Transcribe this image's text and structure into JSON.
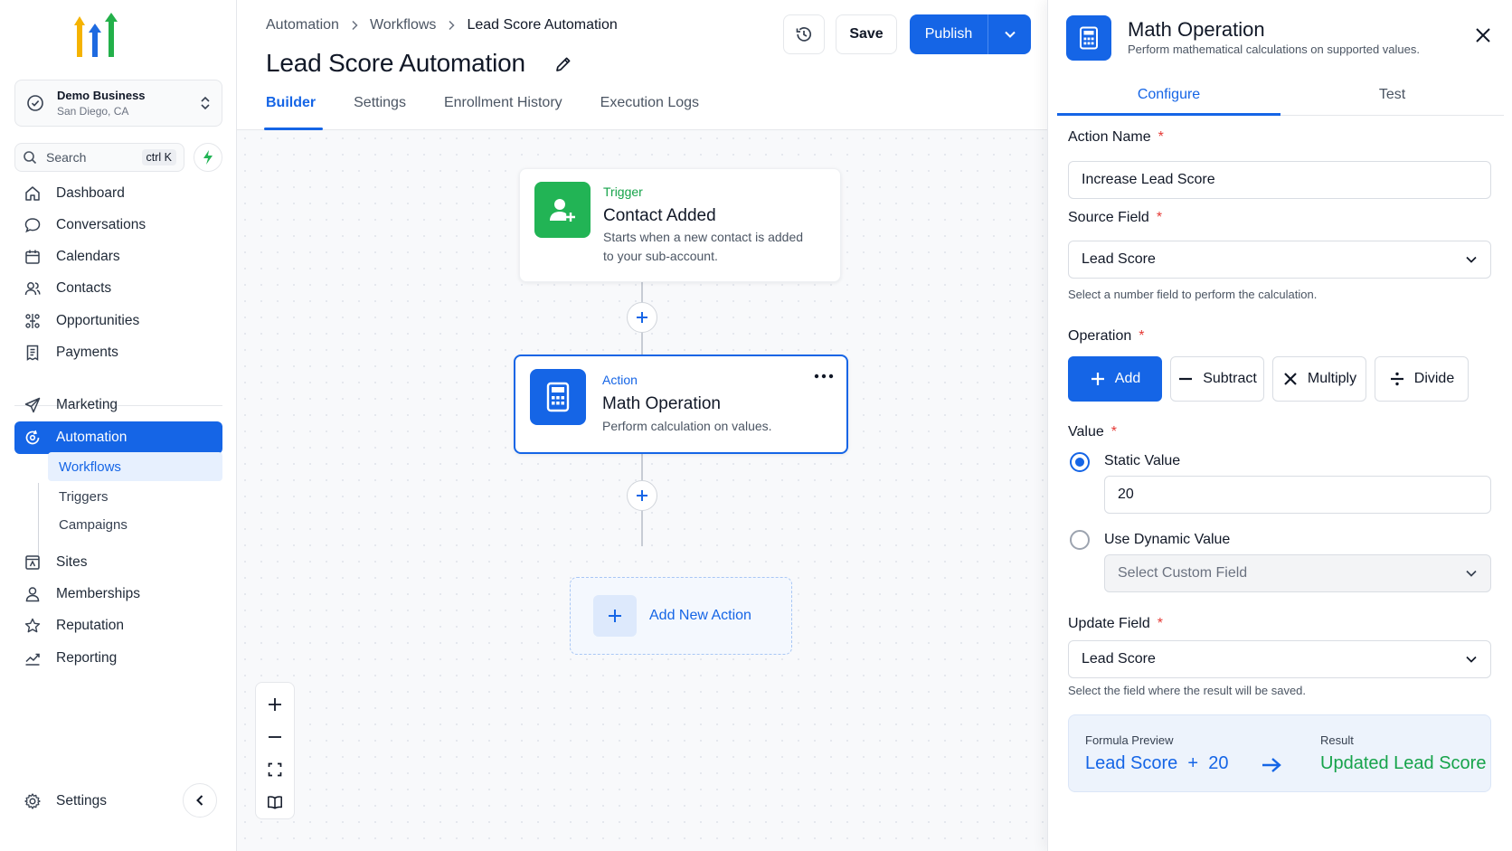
{
  "sidebar": {
    "business": {
      "name": "Demo Business",
      "location": "San Diego, CA"
    },
    "search": {
      "placeholder": "Search",
      "shortcut": "ctrl K"
    },
    "nav": [
      {
        "label": "Dashboard",
        "icon": "home-icon"
      },
      {
        "label": "Conversations",
        "icon": "chat-bubble-icon"
      },
      {
        "label": "Calendars",
        "icon": "calendar-icon"
      },
      {
        "label": "Contacts",
        "icon": "users-icon"
      },
      {
        "label": "Opportunities",
        "icon": "funnel-icon"
      },
      {
        "label": "Payments",
        "icon": "receipt-icon"
      },
      {
        "label": "Marketing",
        "icon": "send-icon"
      },
      {
        "label": "Automation",
        "icon": "automation-icon"
      },
      {
        "label": "Sites",
        "icon": "sites-icon"
      },
      {
        "label": "Memberships",
        "icon": "user-icon"
      },
      {
        "label": "Reputation",
        "icon": "star-icon"
      },
      {
        "label": "Reporting",
        "icon": "chart-line-icon"
      }
    ],
    "sub_nav": [
      "Workflows",
      "Triggers",
      "Campaigns"
    ],
    "settings_label": "Settings"
  },
  "header": {
    "breadcrumbs": [
      "Automation",
      "Workflows",
      "Lead Score Automation"
    ],
    "title": "Lead Score Automation",
    "tabs": [
      "Builder",
      "Settings",
      "Enrollment History",
      "Execution Logs"
    ],
    "save_label": "Save",
    "publish_label": "Publish"
  },
  "canvas": {
    "trigger": {
      "kind": "Trigger",
      "name": "Contact Added",
      "desc_line1": "Starts when a new contact is added",
      "desc_line2": "to your sub-account."
    },
    "action": {
      "kind": "Action",
      "name": "Math Operation",
      "desc": "Perform calculation on values."
    },
    "add_action_label": "Add New Action"
  },
  "panel": {
    "title": "Math Operation",
    "subtitle": "Perform mathematical calculations on supported values.",
    "tabs": [
      "Configure",
      "Test"
    ],
    "action_name": {
      "label": "Action Name",
      "value": "Increase Lead Score"
    },
    "source_field": {
      "label": "Source Field",
      "value": "Lead Score",
      "hint": "Select a number field to perform the calculation."
    },
    "operation": {
      "label": "Operation",
      "options": [
        "Add",
        "Subtract",
        "Multiply",
        "Divide"
      ],
      "selected": "Add"
    },
    "value": {
      "label": "Value",
      "static_label": "Static Value",
      "static_value": "20",
      "dynamic_label": "Use Dynamic Value",
      "dynamic_placeholder": "Select Custom Field"
    },
    "update_field": {
      "label": "Update Field",
      "value": "Lead Score",
      "hint": "Select the field where the result will be saved."
    },
    "formula": {
      "preview_label": "Formula Preview",
      "expression": "Lead Score  +  20",
      "result_label": "Result",
      "result": "Updated Lead Score"
    }
  },
  "colors": {
    "accent": "#1565e6",
    "success": "#16a34a",
    "trigger_green": "#22b455"
  }
}
